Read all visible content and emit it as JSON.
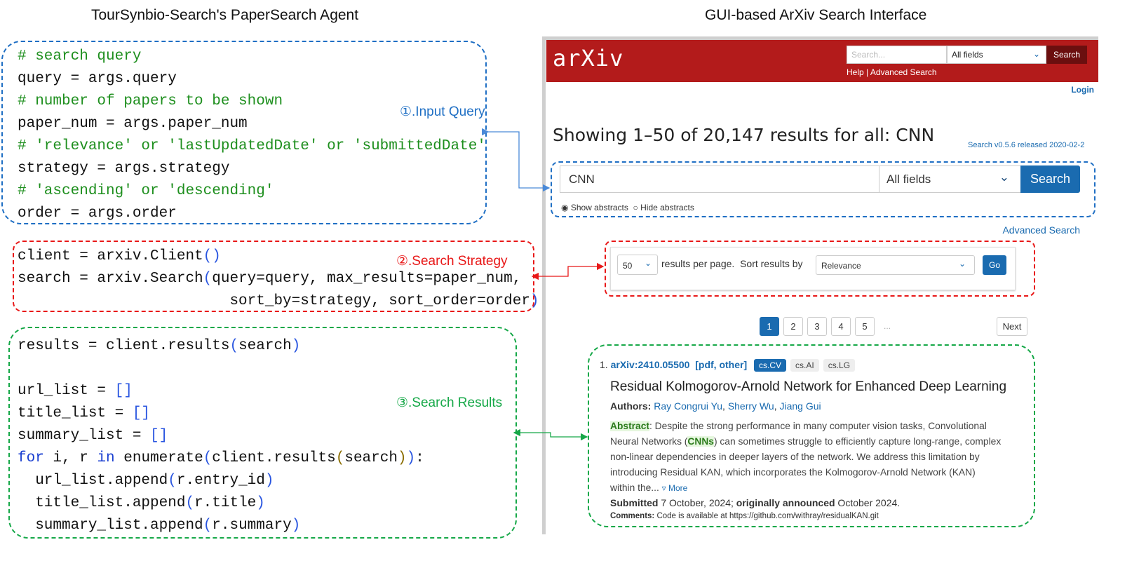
{
  "titles": {
    "left": "TourSynbio-Search's PaperSearch Agent",
    "right": "GUI-based ArXiv Search Interface"
  },
  "labels": {
    "input": "①.Input Query",
    "strategy": "②.Search Strategy",
    "results": "③.Search Results"
  },
  "code": {
    "block1": [
      [
        {
          "t": "# search query",
          "c": "comment"
        }
      ],
      [
        {
          "t": "query = args.query"
        }
      ],
      [
        {
          "t": "# number of papers to be shown",
          "c": "comment"
        }
      ],
      [
        {
          "t": "paper_num = args.paper_num"
        }
      ],
      [
        {
          "t": "# 'relevance' or 'lastUpdatedDate' or 'submittedDate'",
          "c": "comment"
        }
      ],
      [
        {
          "t": "strategy = args.strategy"
        }
      ],
      [
        {
          "t": "# 'ascending' or 'descending'",
          "c": "comment"
        }
      ],
      [
        {
          "t": "order = args.order"
        }
      ]
    ],
    "block2": [
      [
        {
          "t": "client = arxiv.Client"
        },
        {
          "t": "()",
          "c": "paren"
        }
      ],
      [
        {
          "t": "search = arxiv.Search"
        },
        {
          "t": "(",
          "c": "paren"
        },
        {
          "t": "query=query, max_results=paper_num,"
        }
      ],
      [
        {
          "t": "                        sort_by=strategy, sort_order=order"
        },
        {
          "t": ")",
          "c": "paren"
        }
      ]
    ],
    "block3": [
      [
        {
          "t": "results = client.results"
        },
        {
          "t": "(",
          "c": "paren"
        },
        {
          "t": "search"
        },
        {
          "t": ")",
          "c": "paren"
        }
      ],
      [
        {
          "t": ""
        }
      ],
      [
        {
          "t": "url_list = "
        },
        {
          "t": "[]",
          "c": "paren"
        }
      ],
      [
        {
          "t": "title_list = "
        },
        {
          "t": "[]",
          "c": "paren"
        }
      ],
      [
        {
          "t": "summary_list = "
        },
        {
          "t": "[]",
          "c": "paren"
        }
      ],
      [
        {
          "t": "for",
          "c": "kw"
        },
        {
          "t": " i, r "
        },
        {
          "t": "in",
          "c": "kw"
        },
        {
          "t": " enumerate"
        },
        {
          "t": "(",
          "c": "paren"
        },
        {
          "t": "client.results"
        },
        {
          "t": "(",
          "c": "paren2"
        },
        {
          "t": "search"
        },
        {
          "t": ")",
          "c": "paren2"
        },
        {
          "t": ")",
          "c": "paren"
        },
        {
          "t": ":"
        }
      ],
      [
        {
          "t": "  url_list.append"
        },
        {
          "t": "(",
          "c": "paren"
        },
        {
          "t": "r.entry_id"
        },
        {
          "t": ")",
          "c": "paren"
        }
      ],
      [
        {
          "t": "  title_list.append"
        },
        {
          "t": "(",
          "c": "paren"
        },
        {
          "t": "r.title"
        },
        {
          "t": ")",
          "c": "paren"
        }
      ],
      [
        {
          "t": "  summary_list.append"
        },
        {
          "t": "(",
          "c": "paren"
        },
        {
          "t": "r.summary"
        },
        {
          "t": ")",
          "c": "paren"
        }
      ]
    ]
  },
  "arxiv": {
    "logo": "arXiv",
    "header": {
      "search_placeholder": "Search...",
      "field": "All fields",
      "search_btn": "Search",
      "help": "Help",
      "sep": " | ",
      "advanced": "Advanced Search"
    },
    "login": "Login",
    "heading": "Showing 1–50 of 20,147 results for all: CNN",
    "version": "Search v0.5.6 released 2020-02-2",
    "query": "CNN",
    "field": "All fields",
    "search_btn": "Search",
    "show_abstracts": "Show abstracts",
    "hide_abstracts": "Hide abstracts",
    "advanced_link": "Advanced Search",
    "per_page": "50",
    "per_page_label": "results per page.",
    "sort_label": "Sort results by",
    "sort": "Relevance",
    "go": "Go",
    "pages": [
      "1",
      "2",
      "3",
      "4",
      "5"
    ],
    "ellipsis": "...",
    "next": "Next",
    "result": {
      "num": "1.",
      "id": "arXiv:2410.05500",
      "pdf": "pdf",
      "other": "other",
      "tags": [
        "cs.CV",
        "cs.AI",
        "cs.LG"
      ],
      "title": "Residual Kolmogorov-Arnold Network for Enhanced Deep Learning",
      "authors_label": "Authors:",
      "authors": [
        "Ray Congrui Yu",
        "Sherry Wu",
        "Jiang Gui"
      ],
      "abstract_label": "Abstract",
      "abstract_lines": [
        ": Despite the strong performance in many computer vision tasks, Convolutional",
        "Neural Networks (",
        ") can sometimes struggle to efficiently capture long-range, complex",
        "non-linear dependencies in deeper layers of the network. We address this limitation by",
        "introducing Residual KAN, which incorporates the Kolmogorov-Arnold Network (KAN)",
        "within the... "
      ],
      "highlight": "CNNs",
      "more": "▿ More",
      "submitted_label": "Submitted",
      "submitted": " 7 October, 2024; ",
      "announced_label": "originally announced",
      "announced": " October 2024.",
      "comments_label": "Comments:",
      "comments": " Code is available at https://github.com/withray/residualKAN.git"
    }
  },
  "colors": {
    "blue": "#1f6fc4",
    "red": "#e81818",
    "green": "#16a848",
    "arxiv_red": "#b31b1b",
    "arxiv_blue": "#1a6bb0"
  }
}
